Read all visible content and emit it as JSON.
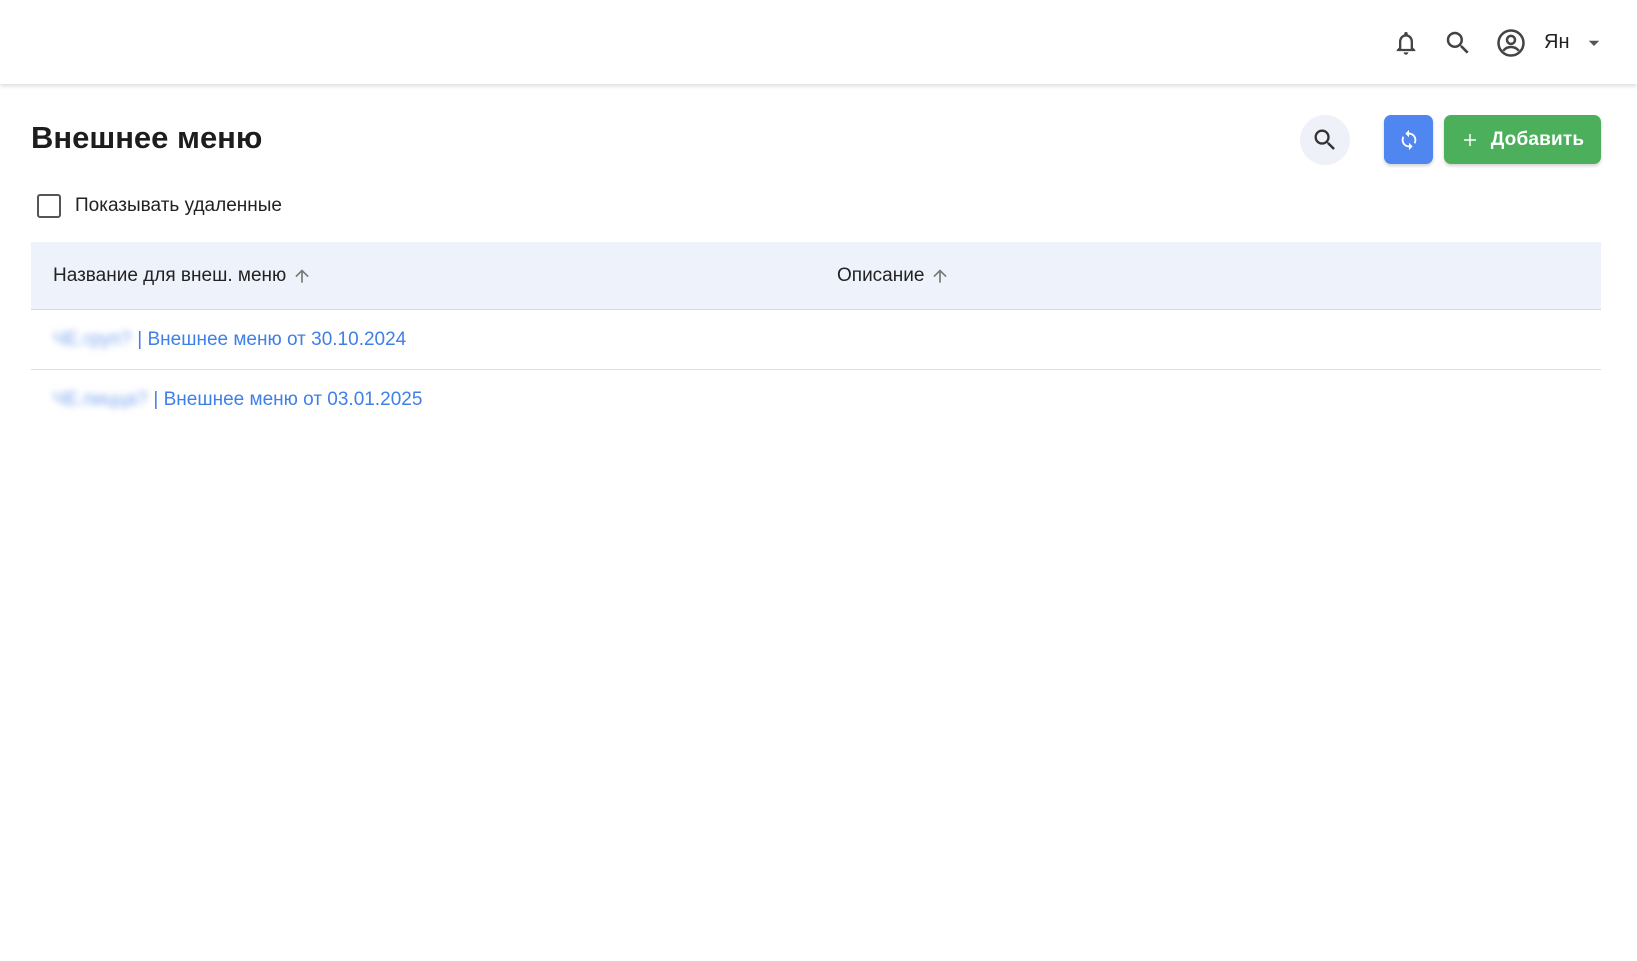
{
  "header": {
    "user_name": "Ян",
    "icons": [
      "bell-icon",
      "search-icon",
      "account-circle-icon",
      "caret-down-icon"
    ]
  },
  "page": {
    "title": "Внешнее меню"
  },
  "toolbar": {
    "search_icon": "search-icon",
    "refresh_icon": "refresh-icon",
    "add_label": "Добавить",
    "colors": {
      "refresh": "#4f86f0",
      "add": "#4caf5b"
    }
  },
  "filters": {
    "show_deleted_label": "Показывать удаленные",
    "show_deleted_checked": false
  },
  "table": {
    "columns": [
      {
        "label": "Название для внеш. меню",
        "sort": "asc"
      },
      {
        "label": "Описание",
        "sort": "asc"
      }
    ],
    "rows": [
      {
        "name_prefix": "ЧЕ.груп?",
        "name": "| Внешнее меню от 30.10.2024",
        "description": ""
      },
      {
        "name_prefix": "ЧЕ.пицца?",
        "name": "| Внешнее меню от 03.01.2025",
        "description": ""
      }
    ],
    "link_color": "#3f7fe8"
  }
}
